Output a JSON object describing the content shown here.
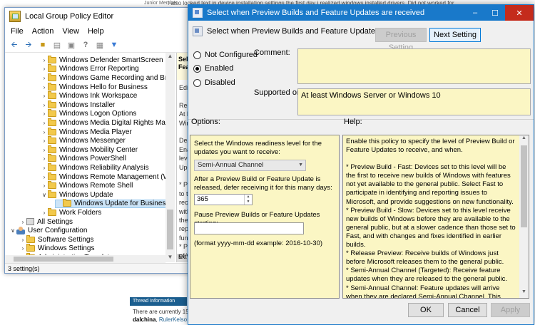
{
  "forum": {
    "junior": "Junior Member",
    "bg_line": "I also looked text in device installation settings the first day i realized windows installed drivers. Did not worked for",
    "thread_header": "Thread Information",
    "thread_line": "There are currently 15",
    "thread_users_bold": "dalchina",
    "thread_users_link": "RulerKelso"
  },
  "gpe": {
    "title": "Local Group Policy Editor",
    "menu": [
      "File",
      "Action",
      "View",
      "Help"
    ],
    "toolbar_icons": [
      "back-arrow-icon",
      "forward-arrow-icon",
      "folder-up-icon",
      "properties-icon",
      "export-icon",
      "help-icon",
      "console-icon",
      "filter-icon"
    ],
    "tree": [
      {
        "label": "Windows Defender SmartScreen",
        "level": 3
      },
      {
        "label": "Windows Error Reporting",
        "level": 3
      },
      {
        "label": "Windows Game Recording and Broadcasting",
        "level": 3
      },
      {
        "label": "Windows Hello for Business",
        "level": 3
      },
      {
        "label": "Windows Ink Workspace",
        "level": 3
      },
      {
        "label": "Windows Installer",
        "level": 3
      },
      {
        "label": "Windows Logon Options",
        "level": 3
      },
      {
        "label": "Windows Media Digital Rights Management",
        "level": 3
      },
      {
        "label": "Windows Media Player",
        "level": 3
      },
      {
        "label": "Windows Messenger",
        "level": 3
      },
      {
        "label": "Windows Mobility Center",
        "level": 3
      },
      {
        "label": "Windows PowerShell",
        "level": 3
      },
      {
        "label": "Windows Reliability Analysis",
        "level": 3
      },
      {
        "label": "Windows Remote Management (WinRM)",
        "level": 3
      },
      {
        "label": "Windows Remote Shell",
        "level": 3
      },
      {
        "label": "Windows Update",
        "level": 3,
        "expanded": true
      },
      {
        "label": "Windows Update for Business",
        "level": 4,
        "selected": true
      },
      {
        "label": "Work Folders",
        "level": 3
      },
      {
        "label": "All Settings",
        "level": 2,
        "icon": "settings"
      },
      {
        "label": "User Configuration",
        "level": 1,
        "icon": "user",
        "expanded": true
      },
      {
        "label": "Software Settings",
        "level": 2
      },
      {
        "label": "Windows Settings",
        "level": 2
      },
      {
        "label": "Administrative Templates",
        "level": 2
      }
    ],
    "right_pane": {
      "header": "Sel Fea",
      "lines": [
        "Edi",
        "",
        "Req",
        "At l",
        "Win",
        "",
        "Des",
        "Ena",
        "leve",
        "Upd",
        "",
        "* P",
        "to t",
        "rece",
        "with",
        "the",
        "repo",
        "func",
        "* P",
        "of V"
      ],
      "ext_tab": "Ext"
    },
    "status": "3 setting(s)"
  },
  "dialog": {
    "title": "Select when Preview Builds and Feature Updates are received",
    "window_buttons": [
      "–",
      "☐",
      "✕"
    ],
    "header_text": "Select when Preview Builds and Feature Updates are received",
    "prev_button": "Previous Setting",
    "next_button": "Next Setting",
    "radios": [
      {
        "label": "Not Configured",
        "checked": false
      },
      {
        "label": "Enabled",
        "checked": true
      },
      {
        "label": "Disabled",
        "checked": false
      }
    ],
    "comment_label": "Comment:",
    "supported_label": "Supported on:",
    "supported_value": "At least Windows Server or Windows 10",
    "options_label": "Options:",
    "help_label": "Help:",
    "options": {
      "readiness_label": "Select the Windows readiness level for the updates you want to receive:",
      "readiness_value": "Semi-Annual Channel",
      "defer_label": "After a Preview Build or Feature Update is released, defer receiving it for this many days:",
      "defer_value": "365",
      "pause_label": "Pause Preview Builds or Feature Updates starting:",
      "pause_value": "",
      "format_hint": "(format yyyy-mm-dd example: 2016-10-30)"
    },
    "help": [
      "Enable this policy to specify the level of Preview Build or Feature Updates to receive, and when.",
      "* Preview Build - Fast: Devices set to this level will be the first to receive new builds of Windows with features not yet available to the general public. Select Fast to participate in identifying and reporting issues to Microsoft, and provide suggestions on new functionality.",
      "* Preview Build - Slow: Devices set to this level receive new builds of Windows before they are available to the general public, but at a slower cadence than those set to Fast, and with changes and fixes identified in earlier builds.",
      "* Release Preview: Receive builds of Windows just before Microsoft releases them to the general public.",
      "* Semi-Annual Channel (Targeted): Receive feature updates when they are released to the general public.",
      "* Semi-Annual Channel: Feature updates will arrive when they are declared Semi-Annual Channel. This usually occurs about 4 months after Semi-Annual Channel (Targeted), indicating that"
    ],
    "ok_button": "OK",
    "cancel_button": "Cancel",
    "apply_button": "Apply"
  }
}
